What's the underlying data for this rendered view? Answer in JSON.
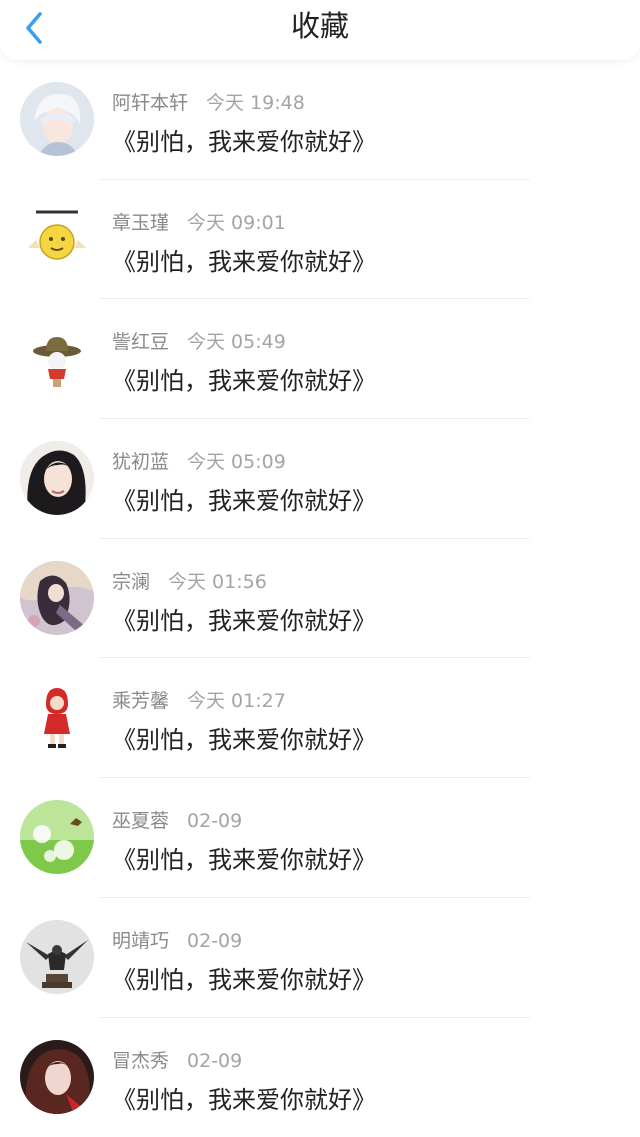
{
  "header": {
    "title": "收藏",
    "back_icon": "chevron-left-icon",
    "accent_color": "#3a9df0"
  },
  "favorites": [
    {
      "name": "阿轩本轩",
      "time": "今天 19:48",
      "content": "《别怕，我来爱你就好》",
      "avatar": "anime-boy-white-hair"
    },
    {
      "name": "章玉瑾",
      "time": "今天 09:01",
      "content": "《别怕，我来爱你就好》",
      "avatar": "emoji-moon-sticker"
    },
    {
      "name": "訾红豆",
      "time": "今天 05:49",
      "content": "《别怕，我来爱你就好》",
      "avatar": "cowboy-hat-figure"
    },
    {
      "name": "犹初蓝",
      "time": "今天 05:09",
      "content": "《别怕，我来爱你就好》",
      "avatar": "girl-long-hair"
    },
    {
      "name": "宗澜",
      "time": "今天 01:56",
      "content": "《别怕，我来爱你就好》",
      "avatar": "anime-illustration"
    },
    {
      "name": "乘芳馨",
      "time": "今天 01:27",
      "content": "《别怕，我来爱你就好》",
      "avatar": "red-hoodie-figure"
    },
    {
      "name": "巫夏蓉",
      "time": "02-09",
      "content": "《别怕，我来爱你就好》",
      "avatar": "dandelion-butterfly"
    },
    {
      "name": "明靖巧",
      "time": "02-09",
      "content": "《别怕，我来爱你就好》",
      "avatar": "eagle-statue"
    },
    {
      "name": "冒杰秀",
      "time": "02-09",
      "content": "《别怕，我来爱你就好》",
      "avatar": "girl-red-tint"
    }
  ]
}
